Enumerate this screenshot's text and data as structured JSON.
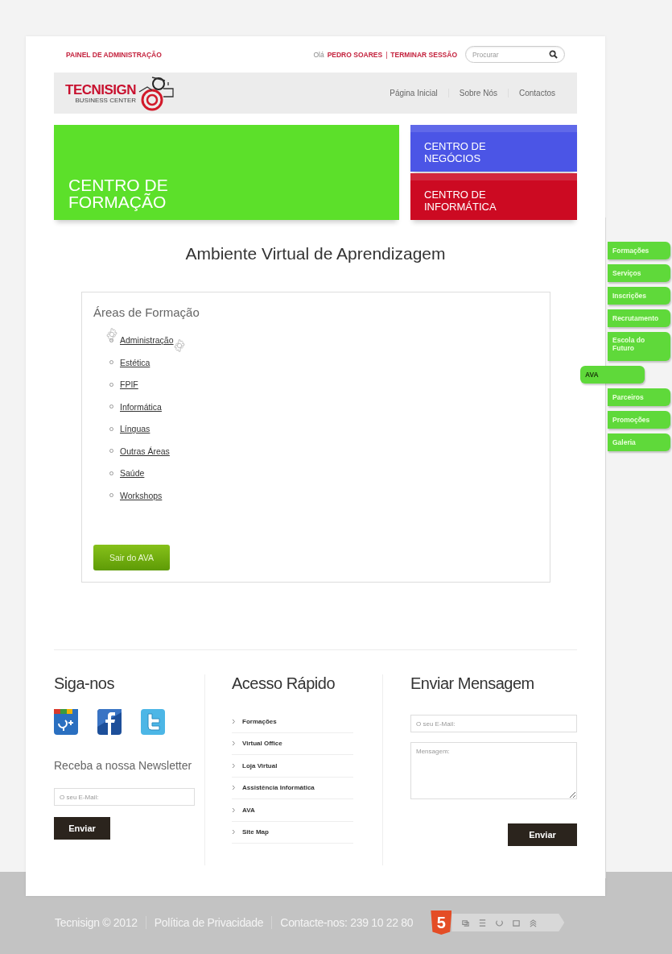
{
  "top_bar": {
    "admin_link": "PAINEL DE ADMINISTRAÇÃO",
    "greeting": "Olá",
    "user_name": "PEDRO SOARES",
    "separator": "|",
    "logout": "TERMINAR SESSÃO",
    "search": {
      "placeholder": "Procurar"
    }
  },
  "logo": {
    "name": "TECNISIGN",
    "tagline": "BUSINESS CENTER"
  },
  "nav": [
    "Página Inicial",
    "Sobre Nós",
    "Contactos"
  ],
  "hero": {
    "main": "CENTRO DE FORMAÇÃO",
    "color": "#5ce02a",
    "side": [
      {
        "label": "CENTRO DE NEGÓCIOS",
        "color": "#4b55e6"
      },
      {
        "label": "CENTRO DE INFORMÁTICA",
        "color": "#cc0a22"
      }
    ]
  },
  "title": "Ambiente Virtual de Aprendizagem",
  "areas": {
    "heading": "Áreas de Formação",
    "items": [
      "Administração",
      "Estética",
      "FPIF",
      "Informática",
      "Línguas",
      "Outras Áreas",
      "Saúde",
      "Workshops"
    ],
    "exit_button": "Sair do AVA"
  },
  "side_menu": [
    {
      "label": "Formações",
      "selected": false
    },
    {
      "label": "Serviços",
      "selected": false
    },
    {
      "label": "Inscrições",
      "selected": false
    },
    {
      "label": "Recrutamento",
      "selected": false
    },
    {
      "label": "Escola do Futuro",
      "selected": false
    },
    {
      "label": "AVA",
      "selected": true
    },
    {
      "label": "Parceiros",
      "selected": false
    },
    {
      "label": "Promoções",
      "selected": false
    },
    {
      "label": "Galeria",
      "selected": false
    }
  ],
  "follow": {
    "heading": "Siga-nos",
    "newsletter_heading": "Receba a nossa Newsletter",
    "email": {
      "placeholder": "O seu E-Mail:"
    },
    "button": "Enviar"
  },
  "quick_access": {
    "heading": "Acesso Rápido",
    "items": [
      "Formações",
      "Virtual Office",
      "Loja Virtual",
      "Assistência Informática",
      "AVA",
      "Site Map"
    ]
  },
  "message": {
    "heading": "Enviar Mensagem",
    "email": {
      "placeholder": "O seu E-Mail:"
    },
    "message": {
      "placeholder": "Mensagem:"
    },
    "button": "Enviar"
  },
  "bottom_footer": {
    "items": [
      "Tecnisign © 2012",
      "Política de Privacidade",
      "Contacte-nos: 239 10 22 80"
    ],
    "html5_badge": "5"
  }
}
